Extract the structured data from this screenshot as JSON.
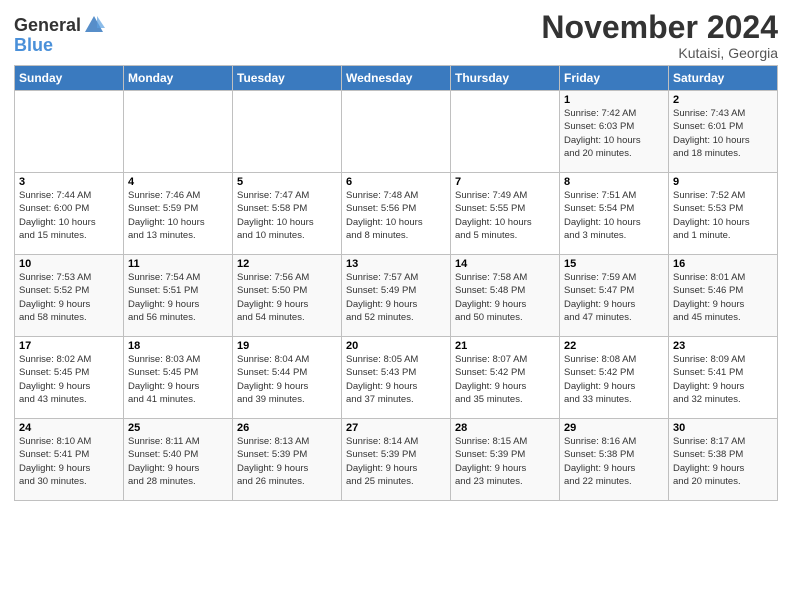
{
  "header": {
    "logo_general": "General",
    "logo_blue": "Blue",
    "title": "November 2024",
    "subtitle": "Kutaisi, Georgia"
  },
  "days_of_week": [
    "Sunday",
    "Monday",
    "Tuesday",
    "Wednesday",
    "Thursday",
    "Friday",
    "Saturday"
  ],
  "weeks": [
    {
      "days": [
        {
          "num": "",
          "detail": ""
        },
        {
          "num": "",
          "detail": ""
        },
        {
          "num": "",
          "detail": ""
        },
        {
          "num": "",
          "detail": ""
        },
        {
          "num": "",
          "detail": ""
        },
        {
          "num": "1",
          "detail": "Sunrise: 7:42 AM\nSunset: 6:03 PM\nDaylight: 10 hours\nand 20 minutes."
        },
        {
          "num": "2",
          "detail": "Sunrise: 7:43 AM\nSunset: 6:01 PM\nDaylight: 10 hours\nand 18 minutes."
        }
      ]
    },
    {
      "days": [
        {
          "num": "3",
          "detail": "Sunrise: 7:44 AM\nSunset: 6:00 PM\nDaylight: 10 hours\nand 15 minutes."
        },
        {
          "num": "4",
          "detail": "Sunrise: 7:46 AM\nSunset: 5:59 PM\nDaylight: 10 hours\nand 13 minutes."
        },
        {
          "num": "5",
          "detail": "Sunrise: 7:47 AM\nSunset: 5:58 PM\nDaylight: 10 hours\nand 10 minutes."
        },
        {
          "num": "6",
          "detail": "Sunrise: 7:48 AM\nSunset: 5:56 PM\nDaylight: 10 hours\nand 8 minutes."
        },
        {
          "num": "7",
          "detail": "Sunrise: 7:49 AM\nSunset: 5:55 PM\nDaylight: 10 hours\nand 5 minutes."
        },
        {
          "num": "8",
          "detail": "Sunrise: 7:51 AM\nSunset: 5:54 PM\nDaylight: 10 hours\nand 3 minutes."
        },
        {
          "num": "9",
          "detail": "Sunrise: 7:52 AM\nSunset: 5:53 PM\nDaylight: 10 hours\nand 1 minute."
        }
      ]
    },
    {
      "days": [
        {
          "num": "10",
          "detail": "Sunrise: 7:53 AM\nSunset: 5:52 PM\nDaylight: 9 hours\nand 58 minutes."
        },
        {
          "num": "11",
          "detail": "Sunrise: 7:54 AM\nSunset: 5:51 PM\nDaylight: 9 hours\nand 56 minutes."
        },
        {
          "num": "12",
          "detail": "Sunrise: 7:56 AM\nSunset: 5:50 PM\nDaylight: 9 hours\nand 54 minutes."
        },
        {
          "num": "13",
          "detail": "Sunrise: 7:57 AM\nSunset: 5:49 PM\nDaylight: 9 hours\nand 52 minutes."
        },
        {
          "num": "14",
          "detail": "Sunrise: 7:58 AM\nSunset: 5:48 PM\nDaylight: 9 hours\nand 50 minutes."
        },
        {
          "num": "15",
          "detail": "Sunrise: 7:59 AM\nSunset: 5:47 PM\nDaylight: 9 hours\nand 47 minutes."
        },
        {
          "num": "16",
          "detail": "Sunrise: 8:01 AM\nSunset: 5:46 PM\nDaylight: 9 hours\nand 45 minutes."
        }
      ]
    },
    {
      "days": [
        {
          "num": "17",
          "detail": "Sunrise: 8:02 AM\nSunset: 5:45 PM\nDaylight: 9 hours\nand 43 minutes."
        },
        {
          "num": "18",
          "detail": "Sunrise: 8:03 AM\nSunset: 5:45 PM\nDaylight: 9 hours\nand 41 minutes."
        },
        {
          "num": "19",
          "detail": "Sunrise: 8:04 AM\nSunset: 5:44 PM\nDaylight: 9 hours\nand 39 minutes."
        },
        {
          "num": "20",
          "detail": "Sunrise: 8:05 AM\nSunset: 5:43 PM\nDaylight: 9 hours\nand 37 minutes."
        },
        {
          "num": "21",
          "detail": "Sunrise: 8:07 AM\nSunset: 5:42 PM\nDaylight: 9 hours\nand 35 minutes."
        },
        {
          "num": "22",
          "detail": "Sunrise: 8:08 AM\nSunset: 5:42 PM\nDaylight: 9 hours\nand 33 minutes."
        },
        {
          "num": "23",
          "detail": "Sunrise: 8:09 AM\nSunset: 5:41 PM\nDaylight: 9 hours\nand 32 minutes."
        }
      ]
    },
    {
      "days": [
        {
          "num": "24",
          "detail": "Sunrise: 8:10 AM\nSunset: 5:41 PM\nDaylight: 9 hours\nand 30 minutes."
        },
        {
          "num": "25",
          "detail": "Sunrise: 8:11 AM\nSunset: 5:40 PM\nDaylight: 9 hours\nand 28 minutes."
        },
        {
          "num": "26",
          "detail": "Sunrise: 8:13 AM\nSunset: 5:39 PM\nDaylight: 9 hours\nand 26 minutes."
        },
        {
          "num": "27",
          "detail": "Sunrise: 8:14 AM\nSunset: 5:39 PM\nDaylight: 9 hours\nand 25 minutes."
        },
        {
          "num": "28",
          "detail": "Sunrise: 8:15 AM\nSunset: 5:39 PM\nDaylight: 9 hours\nand 23 minutes."
        },
        {
          "num": "29",
          "detail": "Sunrise: 8:16 AM\nSunset: 5:38 PM\nDaylight: 9 hours\nand 22 minutes."
        },
        {
          "num": "30",
          "detail": "Sunrise: 8:17 AM\nSunset: 5:38 PM\nDaylight: 9 hours\nand 20 minutes."
        }
      ]
    }
  ]
}
